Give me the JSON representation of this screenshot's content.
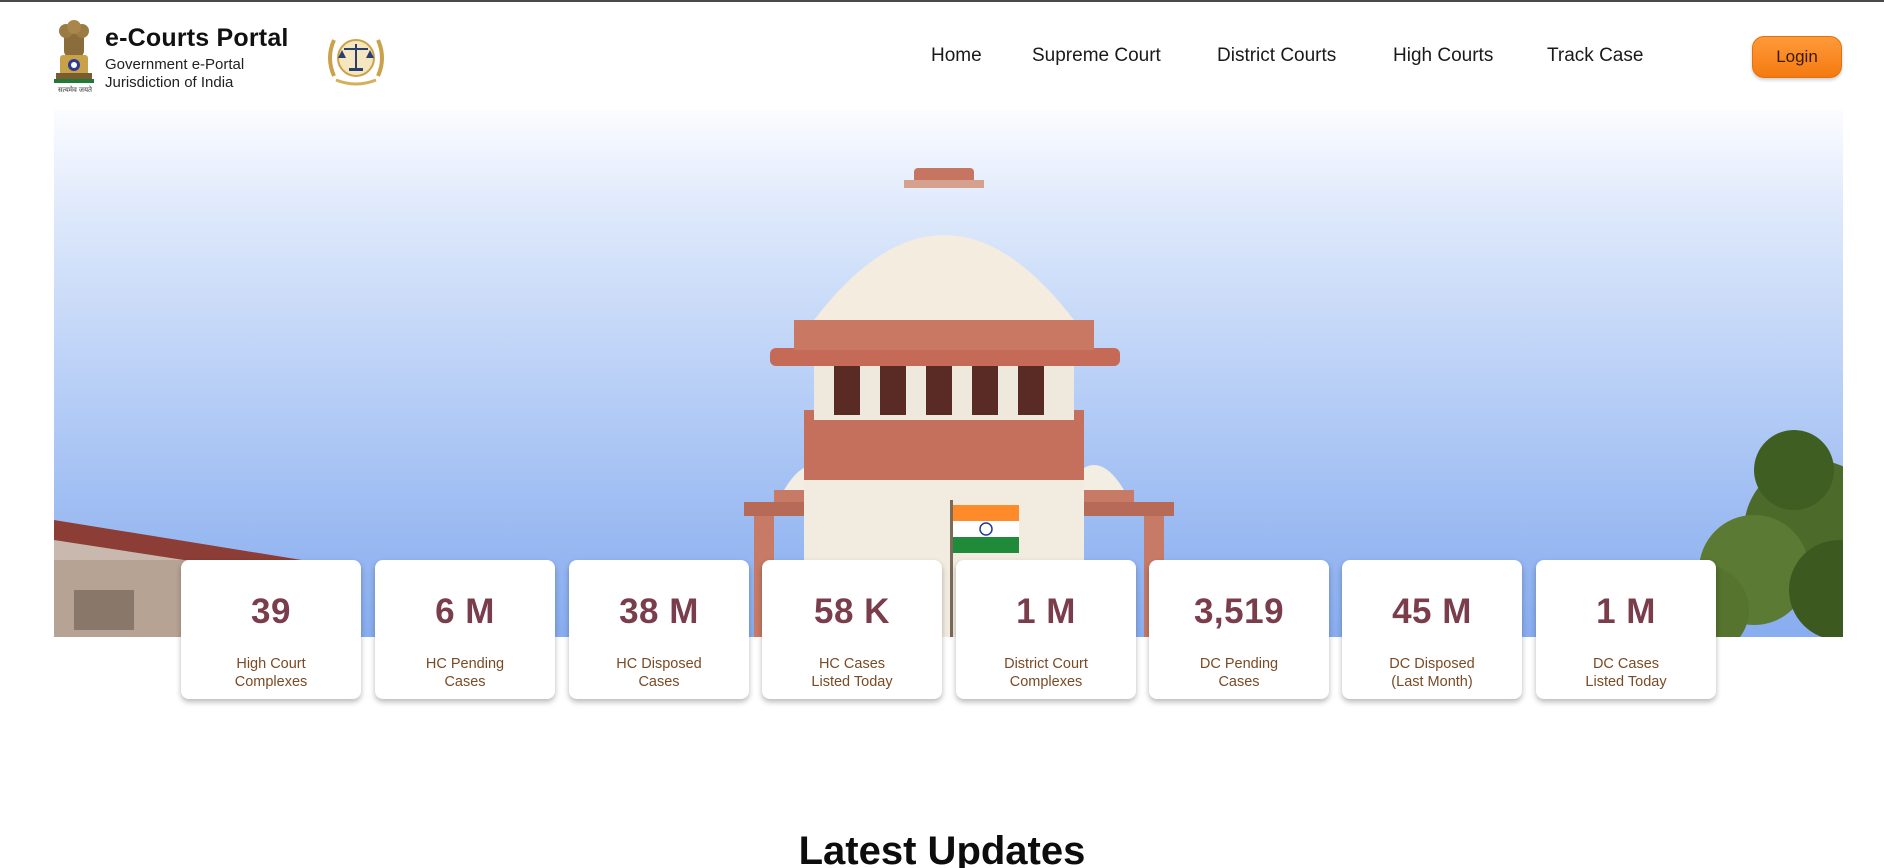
{
  "header": {
    "title": "e-Courts Portal",
    "subtitle_line1": "Government e-Portal",
    "subtitle_line2": "Jurisdiction of India",
    "emblem_caption": "सत्यमेव जयते",
    "emblem_icon": "national-emblem-icon",
    "seal_icon": "justice-scales-seal-icon"
  },
  "nav": {
    "items": [
      {
        "label": "Home"
      },
      {
        "label": "Supreme Court"
      },
      {
        "label": "District Courts"
      },
      {
        "label": "High Courts"
      },
      {
        "label": "Track Case"
      }
    ],
    "login_label": "Login"
  },
  "stats": [
    {
      "value": "39",
      "label": "High Court\nComplexes"
    },
    {
      "value": "6 M",
      "label": "HC Pending\nCases"
    },
    {
      "value": "38 M",
      "label": "HC Disposed\nCases"
    },
    {
      "value": "58 K",
      "label": "HC Cases\nListed Today"
    },
    {
      "value": "1 M",
      "label": "District Court\nComplexes"
    },
    {
      "value": "3,519",
      "label": "DC Pending\nCases"
    },
    {
      "value": "45 M",
      "label": "DC Disposed\n(Last Month)"
    },
    {
      "value": "1 M",
      "label": "DC Cases\nListed Today"
    }
  ],
  "sections": {
    "latest_updates_title": "Latest Updates"
  },
  "colors": {
    "accent": "#f47a10",
    "stat_value": "#7a3d4c",
    "stat_label": "#7a4a24"
  }
}
